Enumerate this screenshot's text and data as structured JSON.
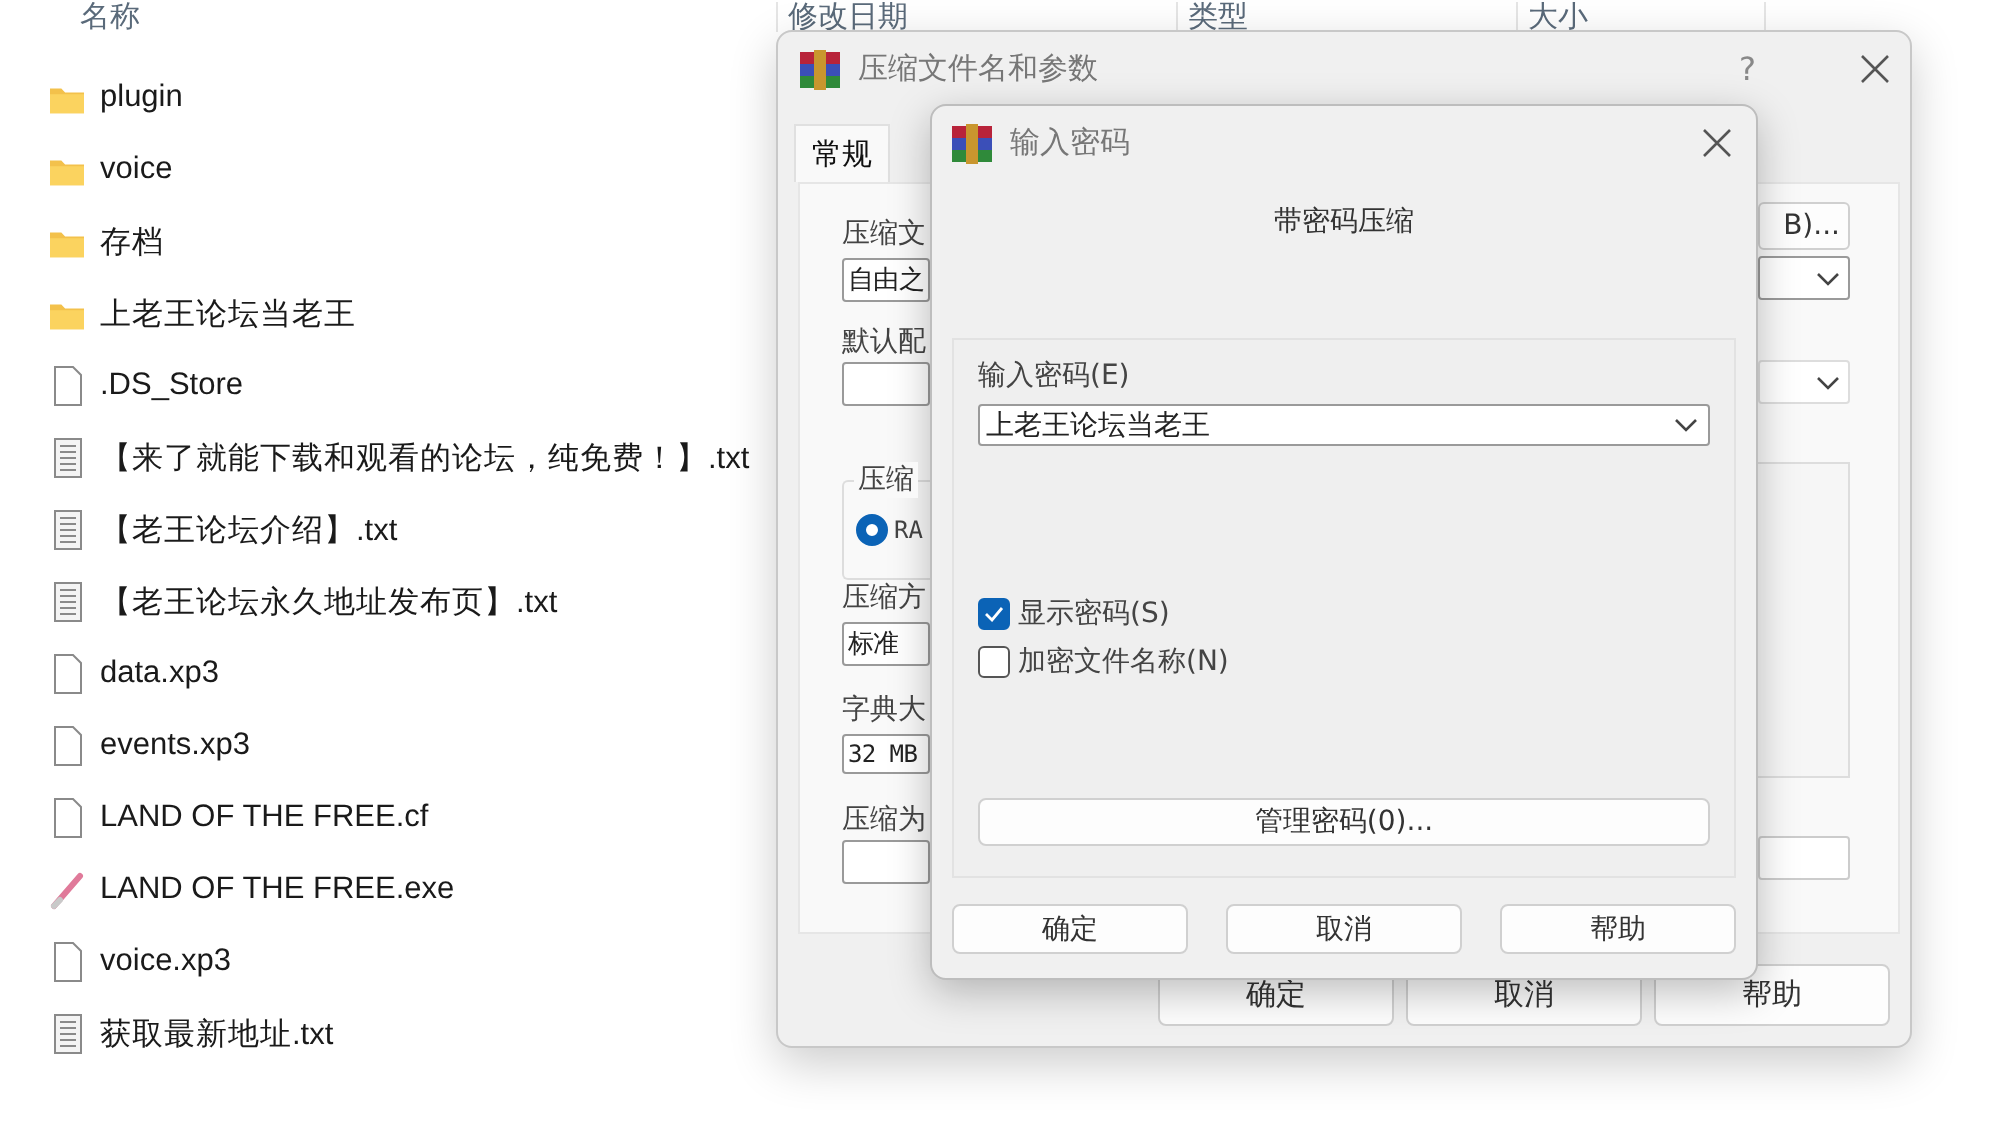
{
  "explorer": {
    "columns": [
      "名称",
      "修改日期",
      "类型",
      "大小"
    ],
    "files": [
      {
        "name": "plugin",
        "kind": "folder"
      },
      {
        "name": "voice",
        "kind": "folder"
      },
      {
        "name": "存档",
        "kind": "folder"
      },
      {
        "name": "上老王论坛当老王",
        "kind": "folder"
      },
      {
        "name": ".DS_Store",
        "kind": "file"
      },
      {
        "name": "【来了就能下载和观看的论坛，纯免费！】.txt",
        "kind": "text"
      },
      {
        "name": "【老王论坛介绍】.txt",
        "kind": "text"
      },
      {
        "name": "【老王论坛永久地址发布页】.txt",
        "kind": "text"
      },
      {
        "name": "data.xp3",
        "kind": "file"
      },
      {
        "name": "events.xp3",
        "kind": "file"
      },
      {
        "name": "LAND OF THE FREE.cf",
        "kind": "file"
      },
      {
        "name": "LAND OF THE FREE.exe",
        "kind": "exe"
      },
      {
        "name": "voice.xp3",
        "kind": "file"
      },
      {
        "name": "获取最新地址.txt",
        "kind": "text"
      }
    ]
  },
  "archive_dialog": {
    "title": "压缩文件名和参数",
    "help_glyph": "?",
    "tabs": [
      {
        "label": "常规",
        "selected": true
      }
    ],
    "archive_name_label": "压缩文",
    "archive_name_value": "自由之",
    "browse_button": "B)...",
    "profile_label": "默认配",
    "format_group_label": "压缩",
    "format_option": {
      "label": "RA",
      "selected": true
    },
    "method_label": "压缩方",
    "method_value": "标准",
    "dict_label": "字典大",
    "dict_value": "32 MB",
    "split_label": "压缩为",
    "buttons": [
      "确定",
      "取消",
      "帮助"
    ]
  },
  "password_dialog": {
    "title": "输入密码",
    "heading": "带密码压缩",
    "password_label": "输入密码(E)",
    "password_value": "上老王论坛当老王",
    "options": [
      {
        "label": "显示密码(S)",
        "checked": true
      },
      {
        "label": "加密文件名称(N)",
        "checked": false
      }
    ],
    "manage_button": "管理密码(0)...",
    "buttons": [
      "确定",
      "取消",
      "帮助"
    ]
  }
}
